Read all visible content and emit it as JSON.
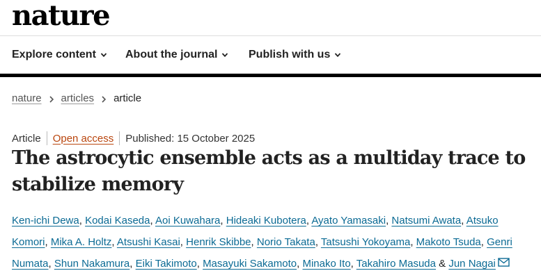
{
  "brand": {
    "logo_text": "nature"
  },
  "nav": {
    "items": [
      {
        "label": "Explore content"
      },
      {
        "label": "About the journal"
      },
      {
        "label": "Publish with us"
      }
    ]
  },
  "breadcrumb": {
    "items": [
      "nature",
      "articles"
    ],
    "current": "article"
  },
  "article": {
    "type": "Article",
    "access": "Open access",
    "published": "Published: 15 October 2025",
    "title": "The astrocytic ensemble acts as a multiday trace to stabilize memory",
    "authors": [
      "Ken-ichi Dewa",
      "Kodai Kaseda",
      "Aoi Kuwahara",
      "Hideaki Kubotera",
      "Ayato Yamasaki",
      "Natsumi Awata",
      "Atsuko Komori",
      "Mika A. Holtz",
      "Atsushi Kasai",
      "Henrik Skibbe",
      "Norio Takata",
      "Tatsushi Yokoyama",
      "Makoto Tsuda",
      "Genri Numata",
      "Shun Nakamura",
      "Eiki Takimoto",
      "Masayuki Sakamoto",
      "Minako Ito",
      "Takahiro Masuda",
      "Jun Nagai"
    ],
    "author_separator": ",",
    "author_conjunction": "&"
  },
  "colors": {
    "link": "#0b6a94",
    "open_access": "#b9450d",
    "rule": "#000000"
  }
}
